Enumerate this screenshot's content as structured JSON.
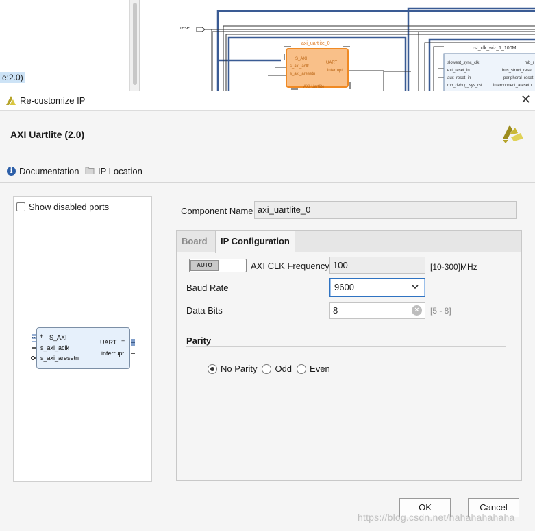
{
  "background_canvas": {
    "version_tag": "e:2.0)",
    "reset_label": "reset",
    "ip_block": {
      "title": "axi_uartlite_0",
      "ports_left": [
        "S_AXI",
        "s_axi_aclk",
        "s_axi_aresetn"
      ],
      "ports_right": [
        "UART",
        "interrupt"
      ],
      "footer": "AXI Uartlite"
    },
    "rst_block": {
      "title": "rst_clk_wiz_1_100M",
      "ports_left": [
        "slowest_sync_clk",
        "ext_reset_in",
        "aux_reset_in",
        "mb_debug_sys_rst"
      ],
      "ports_right": [
        "mb_r",
        "bus_struct_reset",
        "peripheral_reset",
        "interconnect_aresetn"
      ]
    }
  },
  "dialog": {
    "window_title": "Re-customize IP",
    "ip_title": "AXI Uartlite (2.0)",
    "toolbar": {
      "documentation": "Documentation",
      "ip_location": "IP Location"
    },
    "preview": {
      "show_disabled_ports": "Show disabled ports",
      "show_disabled_checked": false,
      "symbol": {
        "left_ports": [
          "S_AXI",
          "s_axi_aclk",
          "s_axi_aresetn"
        ],
        "right_ports": [
          "UART",
          "interrupt"
        ]
      }
    },
    "component_name_label": "Component Name",
    "component_name_value": "axi_uartlite_0",
    "tabs": [
      {
        "label": "Board",
        "active": false
      },
      {
        "label": "IP Configuration",
        "active": true
      }
    ],
    "ip_config": {
      "auto_label": "AUTO",
      "clk_freq_label": "AXI CLK Frequency",
      "clk_freq_value": "100",
      "clk_freq_range": "[10-300]MHz",
      "baud_rate_label": "Baud Rate",
      "baud_rate_value": "9600",
      "data_bits_label": "Data Bits",
      "data_bits_value": "8",
      "data_bits_range": "[5 - 8]",
      "parity_title": "Parity",
      "parity_options": [
        "No Parity",
        "Odd",
        "Even"
      ],
      "parity_selected": "No Parity"
    },
    "buttons": {
      "ok": "OK",
      "cancel": "Cancel"
    },
    "watermark": "https://blog.csdn.net/hahahahahaha"
  },
  "colors": {
    "accent_blue": "#2f73c2",
    "ip_block_orange": "#f39c4a",
    "xilinx_logo_gold": "#b5a32a",
    "wire_blue": "#3a5b94"
  }
}
